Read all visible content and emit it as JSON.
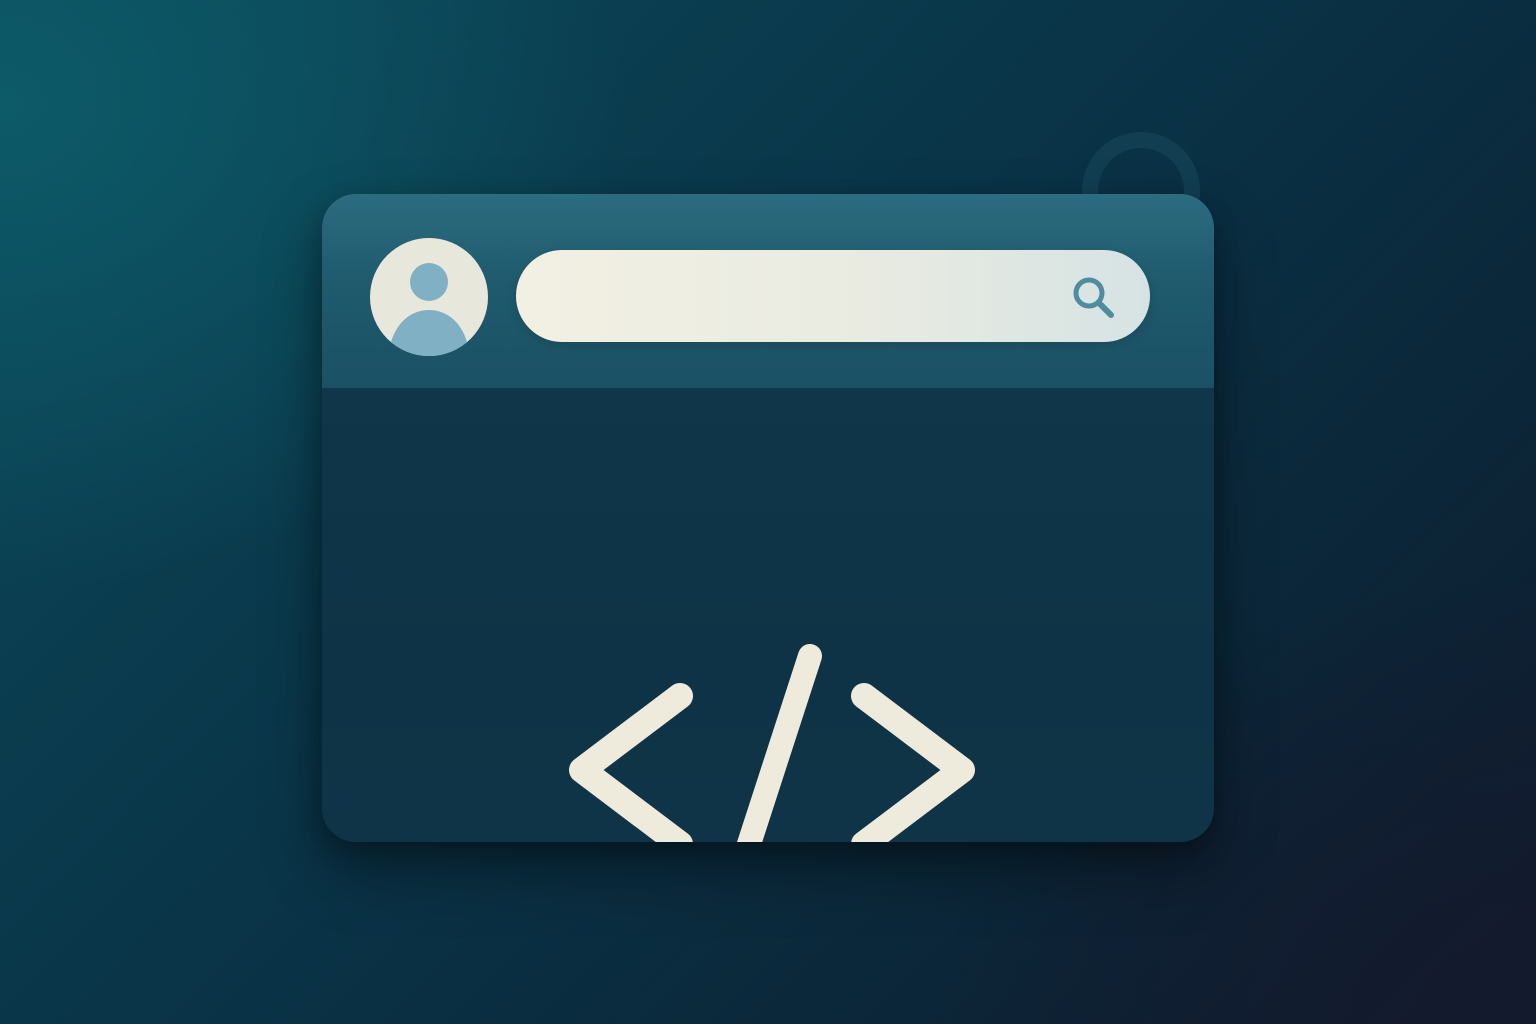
{
  "icons": {
    "avatar": "user-avatar-icon",
    "search": "search-icon",
    "code": "code-brackets-icon",
    "ring": "ring-decoration"
  },
  "search": {
    "value": "",
    "placeholder": ""
  },
  "colors": {
    "background_top_left": "#0b4a5a",
    "background_bottom_right": "#101a2c",
    "titlebar": "#1f5a6d",
    "content": "#0e3548",
    "search_bar": "#f2f0e3",
    "avatar_bg": "#e8e7dc",
    "avatar_figure": "#7fb0c4",
    "code_glyph": "#efebdc",
    "search_icon": "#4f8d9e"
  }
}
